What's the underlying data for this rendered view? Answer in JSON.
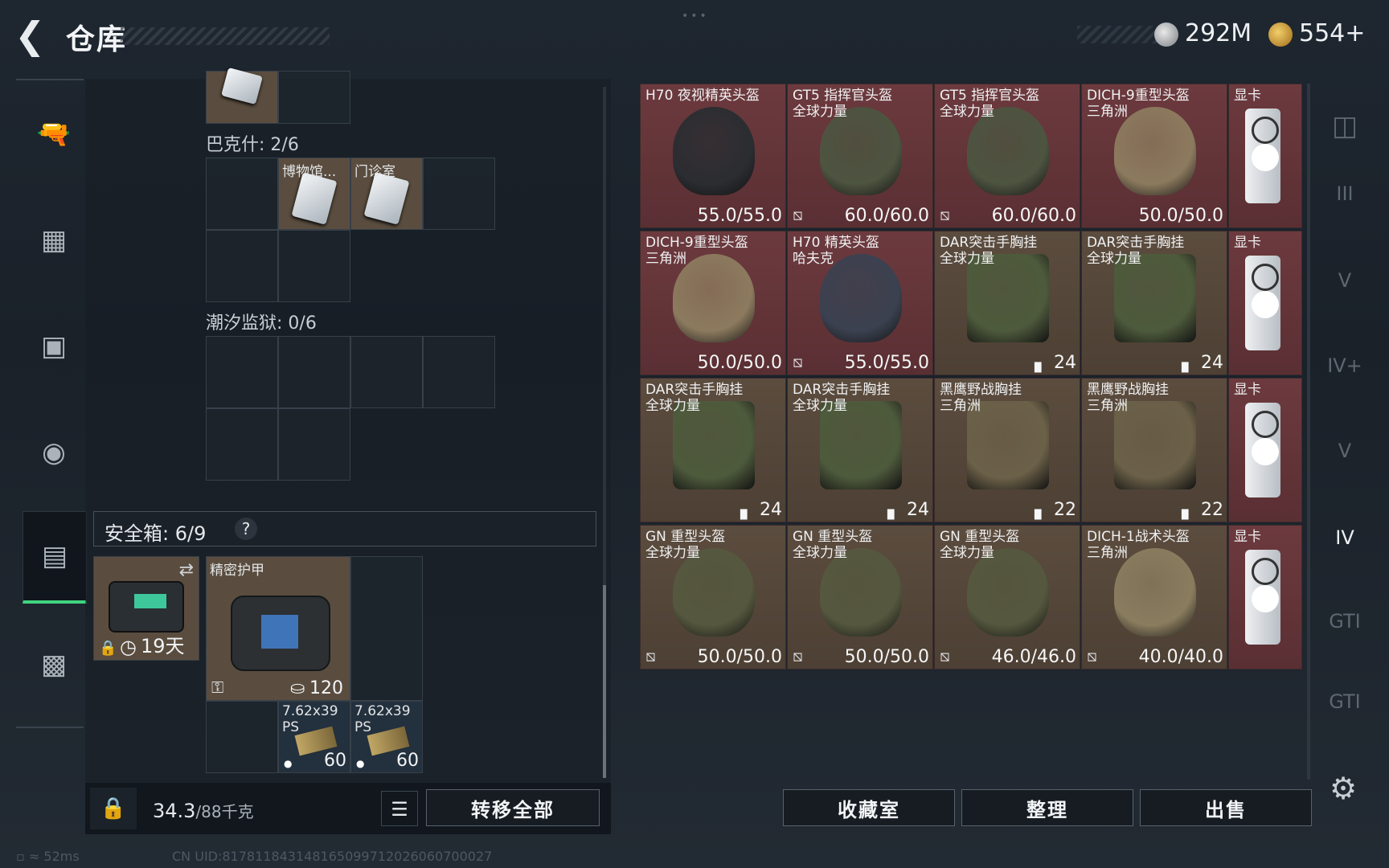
{
  "header": {
    "back_icon": "back-arrow-icon",
    "title": "仓库",
    "currency1": {
      "icon": "silver-coin-icon",
      "amount": "292M"
    },
    "currency2": {
      "icon": "gold-coin-icon",
      "amount": "554+"
    }
  },
  "left_nav": [
    {
      "icon": "pistol-icon"
    },
    {
      "icon": "armor-icon"
    },
    {
      "icon": "backpack-icon"
    },
    {
      "icon": "bag-icon"
    },
    {
      "icon": "safebox-icon",
      "active": true
    },
    {
      "icon": "briefcase-icon"
    }
  ],
  "storage": {
    "bakeshi_label": "巴克什: 2/6",
    "bakeshi_items": [
      {
        "name": "博物馆..."
      },
      {
        "name": "门诊室"
      }
    ],
    "chaoxi_label": "潮汐监狱: 0/6"
  },
  "safebox": {
    "label": "安全箱: 6/9",
    "help": "?",
    "timer": "19天",
    "armor_name": "精密护甲",
    "armor_value": "120",
    "ammo": [
      {
        "name_line1": "7.62x39",
        "name_line2": "PS",
        "count": "60"
      },
      {
        "name_line1": "7.62x39",
        "name_line2": "PS",
        "count": "60"
      }
    ]
  },
  "bottom_left": {
    "weight": "34.3",
    "weight_max": "/88千克",
    "transfer_all": "转移全部"
  },
  "grid_items": [
    {
      "name": "H70 夜视精英头盔",
      "sub": "",
      "value": "55.0/55.0",
      "nodrop": false,
      "kind": "helmet",
      "color": "red",
      "tint": "#2b2d31"
    },
    {
      "name": "GT5 指挥官头盔",
      "sub": "全球力量",
      "value": "60.0/60.0",
      "nodrop": true,
      "kind": "helmet",
      "color": "red",
      "tint": "#4d5440"
    },
    {
      "name": "GT5 指挥官头盔",
      "sub": "全球力量",
      "value": "60.0/60.0",
      "nodrop": true,
      "kind": "helmet",
      "color": "red",
      "tint": "#4d5440"
    },
    {
      "name": "DICH-9重型头盔",
      "sub": "三角洲",
      "value": "50.0/50.0",
      "nodrop": false,
      "kind": "helmet",
      "color": "red",
      "tint": "#8c7a5e"
    },
    {
      "name": "显卡",
      "sub": "",
      "value": "",
      "nodrop": false,
      "kind": "gpu",
      "color": "red",
      "tint": "#e5e7ea"
    },
    {
      "name": "DICH-9重型头盔",
      "sub": "三角洲",
      "value": "50.0/50.0",
      "nodrop": false,
      "kind": "helmet",
      "color": "red",
      "tint": "#8c7a5e"
    },
    {
      "name": "H70 精英头盔",
      "sub": "哈夫克",
      "value": "55.0/55.0",
      "nodrop": true,
      "kind": "helmet",
      "color": "red",
      "tint": "#3b4150"
    },
    {
      "name": "DAR突击手胸挂",
      "sub": "全球力量",
      "value": "24",
      "nodrop": false,
      "kind": "rig",
      "color": "brown",
      "tint": "#4e5a3c"
    },
    {
      "name": "DAR突击手胸挂",
      "sub": "全球力量",
      "value": "24",
      "nodrop": false,
      "kind": "rig",
      "color": "brown",
      "tint": "#4e5a3c"
    },
    {
      "name": "显卡",
      "sub": "",
      "value": "",
      "nodrop": false,
      "kind": "gpu",
      "color": "red",
      "tint": "#e5e7ea"
    },
    {
      "name": "DAR突击手胸挂",
      "sub": "全球力量",
      "value": "24",
      "nodrop": false,
      "kind": "rig",
      "color": "brown",
      "tint": "#4e5a3c"
    },
    {
      "name": "DAR突击手胸挂",
      "sub": "全球力量",
      "value": "24",
      "nodrop": false,
      "kind": "rig",
      "color": "brown",
      "tint": "#4e5a3c"
    },
    {
      "name": "黑鹰野战胸挂",
      "sub": "三角洲",
      "value": "22",
      "nodrop": false,
      "kind": "rig",
      "color": "brown",
      "tint": "#6b6048"
    },
    {
      "name": "黑鹰野战胸挂",
      "sub": "三角洲",
      "value": "22",
      "nodrop": false,
      "kind": "rig",
      "color": "brown",
      "tint": "#6b6048"
    },
    {
      "name": "显卡",
      "sub": "",
      "value": "",
      "nodrop": false,
      "kind": "gpu",
      "color": "red",
      "tint": "#e5e7ea"
    },
    {
      "name": "GN 重型头盔",
      "sub": "全球力量",
      "value": "50.0/50.0",
      "nodrop": true,
      "kind": "helmet",
      "color": "brown",
      "tint": "#55583e"
    },
    {
      "name": "GN 重型头盔",
      "sub": "全球力量",
      "value": "50.0/50.0",
      "nodrop": true,
      "kind": "helmet",
      "color": "brown",
      "tint": "#55583e"
    },
    {
      "name": "GN 重型头盔",
      "sub": "全球力量",
      "value": "46.0/46.0",
      "nodrop": true,
      "kind": "helmet",
      "color": "brown",
      "tint": "#55583e"
    },
    {
      "name": "DICH-1战术头盔",
      "sub": "三角洲",
      "value": "40.0/40.0",
      "nodrop": true,
      "kind": "helmet",
      "color": "brown",
      "tint": "#8a7c5e"
    },
    {
      "name": "显卡",
      "sub": "",
      "value": "",
      "nodrop": false,
      "kind": "gpu",
      "color": "red",
      "tint": "#e5e7ea"
    }
  ],
  "action_buttons": {
    "collection": "收藏室",
    "sort": "整理",
    "sell": "出售"
  },
  "right_nav": [
    {
      "icon": "container-icon",
      "active": false
    },
    {
      "icon": "tier-iii-icon",
      "active": false
    },
    {
      "icon": "tier-v-icon",
      "active": false
    },
    {
      "icon": "tier-iv-plus-icon",
      "active": false
    },
    {
      "icon": "tier-v-alt-icon",
      "active": false
    },
    {
      "icon": "tier-iv-icon",
      "active": true
    },
    {
      "icon": "gti-icon",
      "active": false
    },
    {
      "icon": "gti-alt-icon",
      "active": false
    }
  ],
  "status": {
    "ping": "52ms",
    "uid": "CN UID:817811843148165099712026060700027"
  }
}
